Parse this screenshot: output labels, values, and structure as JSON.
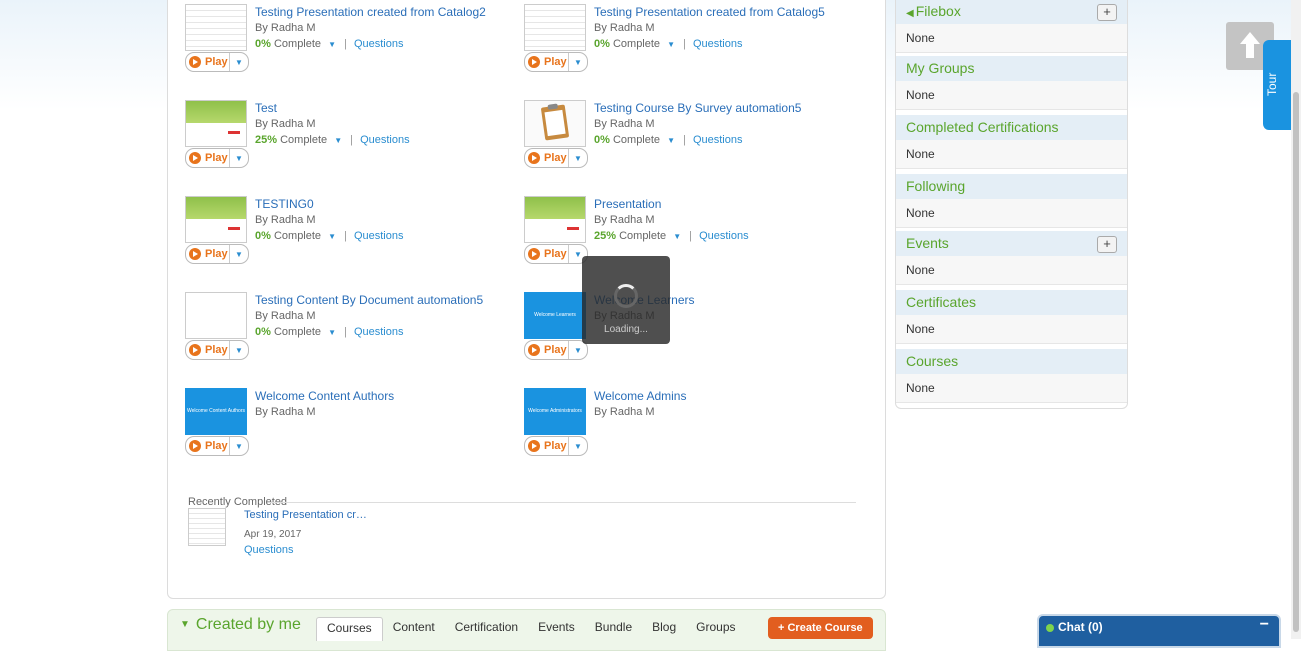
{
  "courses": [
    {
      "title": "Testing Presentation created from Catalog2",
      "author": "By Radha M",
      "percent": "0%",
      "complete_label": "Complete",
      "questions": "Questions",
      "play": "Play"
    },
    {
      "title": "Testing Presentation created from Catalog5",
      "author": "By Radha M",
      "percent": "0%",
      "complete_label": "Complete",
      "questions": "Questions",
      "play": "Play"
    },
    {
      "title": "Test",
      "author": "By Radha M",
      "percent": "25%",
      "complete_label": "Complete",
      "questions": "Questions",
      "play": "Play"
    },
    {
      "title": "Testing Course By Survey automation5",
      "author": "By Radha M",
      "percent": "0%",
      "complete_label": "Complete",
      "questions": "Questions",
      "play": "Play"
    },
    {
      "title": "TESTING0",
      "author": "By Radha M",
      "percent": "0%",
      "complete_label": "Complete",
      "questions": "Questions",
      "play": "Play"
    },
    {
      "title": "Presentation",
      "author": "By Radha M",
      "percent": "25%",
      "complete_label": "Complete",
      "questions": "Questions",
      "play": "Play"
    },
    {
      "title": "Testing Content By Document automation5",
      "author": "By Radha M",
      "percent": "0%",
      "complete_label": "Complete",
      "questions": "Questions",
      "play": "Play"
    },
    {
      "title": "Welcome Learners",
      "author": "By Radha M",
      "play": "Play",
      "thumb_text": "Welcome Learners"
    },
    {
      "title": "Welcome Content Authors",
      "author": "By Radha M",
      "play": "Play",
      "thumb_text": "Welcome Content Authors"
    },
    {
      "title": "Welcome Admins",
      "author": "By Radha M",
      "play": "Play",
      "thumb_text": "Welcome Administrators"
    }
  ],
  "recent": {
    "heading": "Recently Completed",
    "title": "Testing Presentation cr…",
    "date": "Apr 19, 2017",
    "questions": "Questions"
  },
  "loading": "Loading...",
  "created": {
    "title": "Created by me",
    "tabs": [
      "Courses",
      "Content",
      "Certification",
      "Events",
      "Bundle",
      "Blog",
      "Groups"
    ],
    "create_button": "+ Create Course"
  },
  "sidebar": {
    "sections": [
      {
        "title": "Filebox",
        "value": "None"
      },
      {
        "title": "My Groups",
        "value": "None"
      },
      {
        "title": "Completed Certifications",
        "value": "None"
      },
      {
        "title": "Following",
        "value": "None"
      },
      {
        "title": "Events",
        "value": "None"
      },
      {
        "title": "Certificates",
        "value": "None"
      },
      {
        "title": "Courses",
        "value": "None"
      }
    ],
    "plus": "+"
  },
  "tour": "Tour",
  "chat": {
    "label": "Chat  (0)",
    "minimize": "−"
  }
}
